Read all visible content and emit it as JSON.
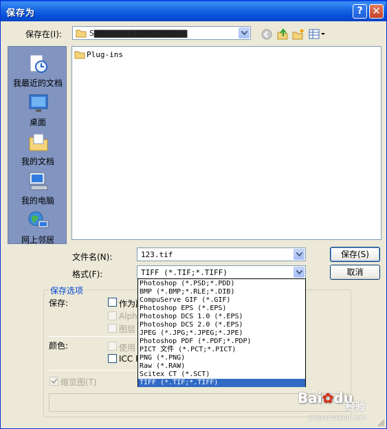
{
  "window": {
    "title": "保存为"
  },
  "location": {
    "label": "保存在(I):",
    "value": "S▇▇▇▇▇▇▇▇▇▇▇▇▇▇▇▇"
  },
  "toolbar_icons": [
    "back-icon",
    "up-folder-icon",
    "new-folder-icon",
    "view-menu-icon"
  ],
  "places": [
    {
      "label": "我最近的文档",
      "icon": "recent-documents-icon"
    },
    {
      "label": "桌面",
      "icon": "desktop-icon"
    },
    {
      "label": "我的文档",
      "icon": "my-documents-icon"
    },
    {
      "label": "我的电脑",
      "icon": "my-computer-icon"
    },
    {
      "label": "网上邻居",
      "icon": "network-places-icon"
    }
  ],
  "files": [
    {
      "name": "Plug-ins",
      "icon": "folder-icon"
    }
  ],
  "filename": {
    "label": "文件名(N):",
    "value": "123.tif"
  },
  "format": {
    "label": "格式(F):",
    "value": "TIFF (*.TIF;*.TIFF)",
    "options": [
      "Photoshop (*.PSD;*.PDD)",
      "BMP (*.BMP;*.RLE;*.DIB)",
      "CompuServe GIF (*.GIF)",
      "Photoshop EPS (*.EPS)",
      "Photoshop DCS 1.0 (*.EPS)",
      "Photoshop DCS 2.0 (*.EPS)",
      "JPEG (*.JPG;*.JPEG;*.JPE)",
      "Photoshop PDF (*.PDF;*.PDP)",
      "PICT 文件 (*.PCT;*.PICT)",
      "PNG (*.PNG)",
      "Raw (*.RAW)",
      "Scitex CT (*.SCT)",
      "TIFF (*.TIF;*.TIFF)"
    ],
    "selected_index": 12
  },
  "buttons": {
    "save": "保存(S)",
    "cancel": "取消"
  },
  "options": {
    "title": "保存选项",
    "save_label": "保存:",
    "as_copy": "作为副",
    "alpha": "Alph",
    "layers": "图层",
    "color_label": "颜色:",
    "use": "使用",
    "icc": "ICC P",
    "thumbnail": "缩览图(T)"
  },
  "watermark": {
    "brand": "Bai",
    "paw": "du",
    "suffix": "经验",
    "url": "jingyan.baidu.com"
  },
  "colors": {
    "title_bar": "#0854DD",
    "selection": "#316AC5",
    "group_title": "#0046D5",
    "face": "#ECE9D8"
  }
}
